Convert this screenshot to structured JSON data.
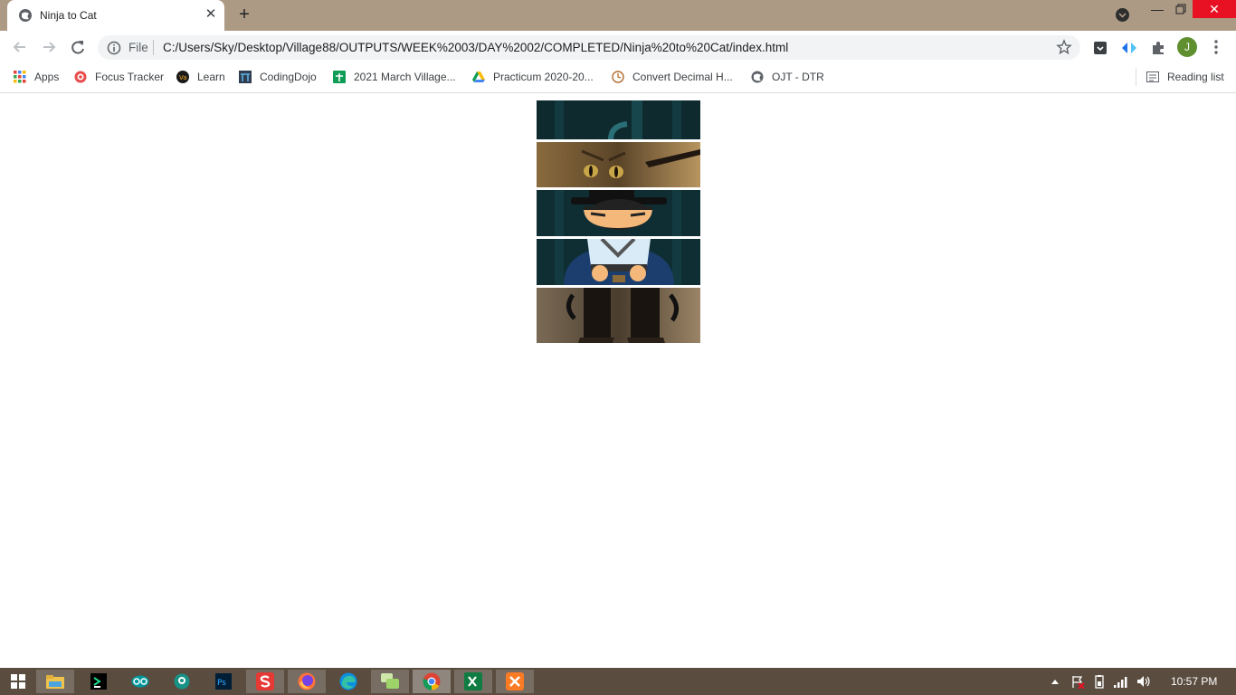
{
  "window": {
    "tab_title": "Ninja to Cat",
    "tab_close": "✕",
    "new_tab": "+",
    "minimize": "—",
    "close": "✕"
  },
  "toolbar": {
    "site_label": "File",
    "url": "C:/Users/Sky/Desktop/Village88/OUTPUTS/WEEK%2003/DAY%2002/COMPLETED/Ninja%20to%20Cat/index.html",
    "profile_initial": "J"
  },
  "bookmarks": {
    "items": [
      {
        "label": "Apps",
        "icon": "apps-grid-icon"
      },
      {
        "label": "Focus Tracker",
        "icon": "focus-tracker-icon"
      },
      {
        "label": "Learn",
        "icon": "learn-icon"
      },
      {
        "label": "CodingDojo",
        "icon": "codingdojo-icon"
      },
      {
        "label": "2021 March Village...",
        "icon": "sheets-icon"
      },
      {
        "label": "Practicum 2020-20...",
        "icon": "drive-icon"
      },
      {
        "label": "Convert Decimal H...",
        "icon": "clock-icon"
      },
      {
        "label": "OJT - DTR",
        "icon": "globe-icon"
      }
    ],
    "reading_list": "Reading list"
  },
  "page": {
    "strips": [
      {
        "name": "ninja-strip-1",
        "palette": "dark-teal"
      },
      {
        "name": "cat-strip-2",
        "palette": "cat-eyes"
      },
      {
        "name": "ninja-strip-3",
        "palette": "ninja-face"
      },
      {
        "name": "ninja-strip-4",
        "palette": "ninja-body"
      },
      {
        "name": "cat-strip-5",
        "palette": "cat-legs"
      }
    ]
  },
  "taskbar": {
    "time": "10:57 PM",
    "apps": [
      "start-icon",
      "file-explorer-icon",
      "pycharm-icon",
      "arduino-icon",
      "gitkraken-icon",
      "photoshop-icon",
      "wps-icon",
      "firefox-icon",
      "edge-icon",
      "chat-icon",
      "chrome-icon",
      "excel-icon",
      "xampp-icon"
    ]
  },
  "colors": {
    "titlebar": "#ad9a85",
    "taskbar": "#5a4d40",
    "close": "#e81123"
  }
}
